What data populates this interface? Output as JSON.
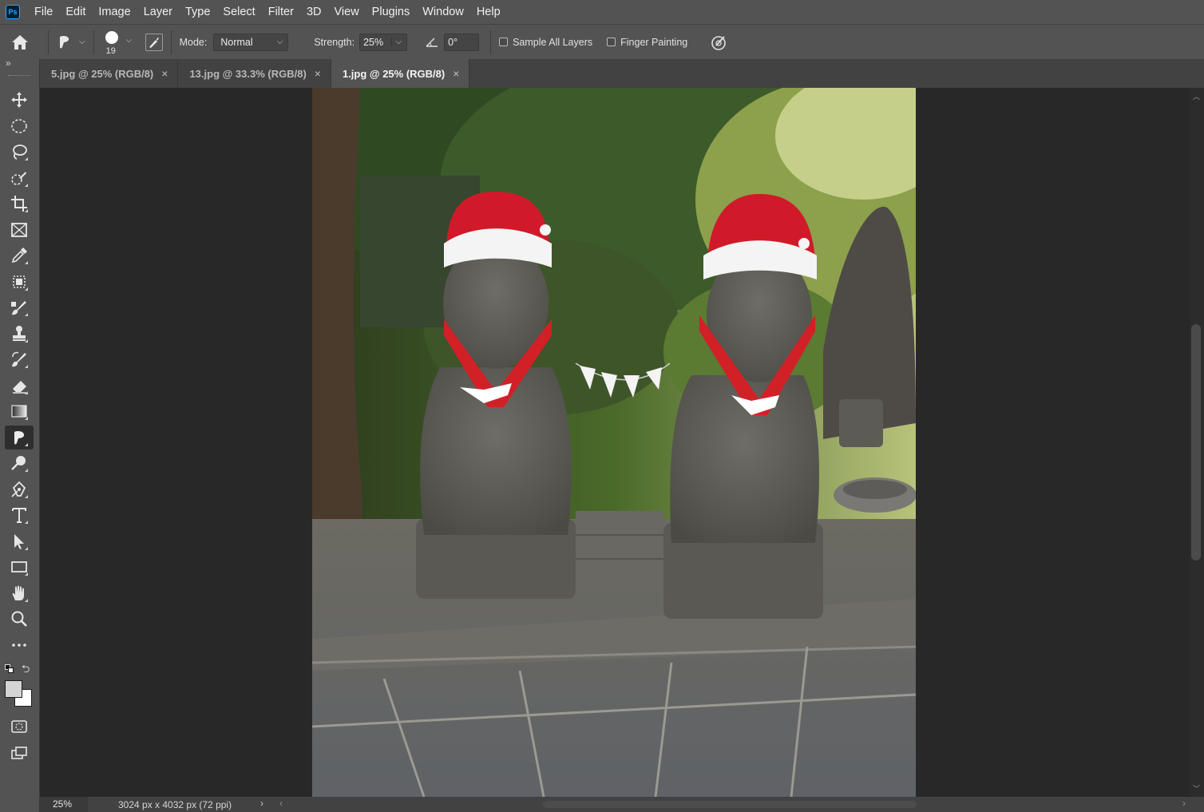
{
  "menu": [
    "File",
    "Edit",
    "Image",
    "Layer",
    "Type",
    "Select",
    "Filter",
    "3D",
    "View",
    "Plugins",
    "Window",
    "Help"
  ],
  "logo": "Ps",
  "options": {
    "brush_size": "19",
    "mode_label": "Mode:",
    "mode_value": "Normal",
    "strength_label": "Strength:",
    "strength_value": "25%",
    "angle_value": "0°",
    "sample_all_layers": "Sample All Layers",
    "finger_painting": "Finger Painting"
  },
  "tabs": [
    {
      "label": "5.jpg @ 25% (RGB/8)",
      "active": false
    },
    {
      "label": "13.jpg @ 33.3% (RGB/8)",
      "active": false
    },
    {
      "label": "1.jpg @ 25% (RGB/8)",
      "active": true
    }
  ],
  "status": {
    "zoom": "25%",
    "doc_info": "3024 px x 4032 px (72 ppi)"
  },
  "toolbar": {
    "collapse_glyph": "»",
    "tools": [
      "move-tool",
      "elliptical-marquee-tool",
      "lasso-tool",
      "quick-selection-tool",
      "crop-tool",
      "frame-tool",
      "eyedropper-tool",
      "patch-tool",
      "healing-brush-tool",
      "clone-stamp-tool",
      "history-brush-tool",
      "eraser-tool",
      "gradient-tool",
      "smudge-tool",
      "dodge-tool",
      "pen-tool",
      "type-tool",
      "path-selection-tool",
      "rectangle-tool",
      "hand-tool",
      "zoom-tool",
      "edit-toolbar"
    ],
    "active_tool": "smudge-tool"
  },
  "colors": {
    "foreground": "#d4d4d4",
    "background": "#ffffff",
    "ui_panel": "#535353",
    "ui_dark": "#282828"
  }
}
